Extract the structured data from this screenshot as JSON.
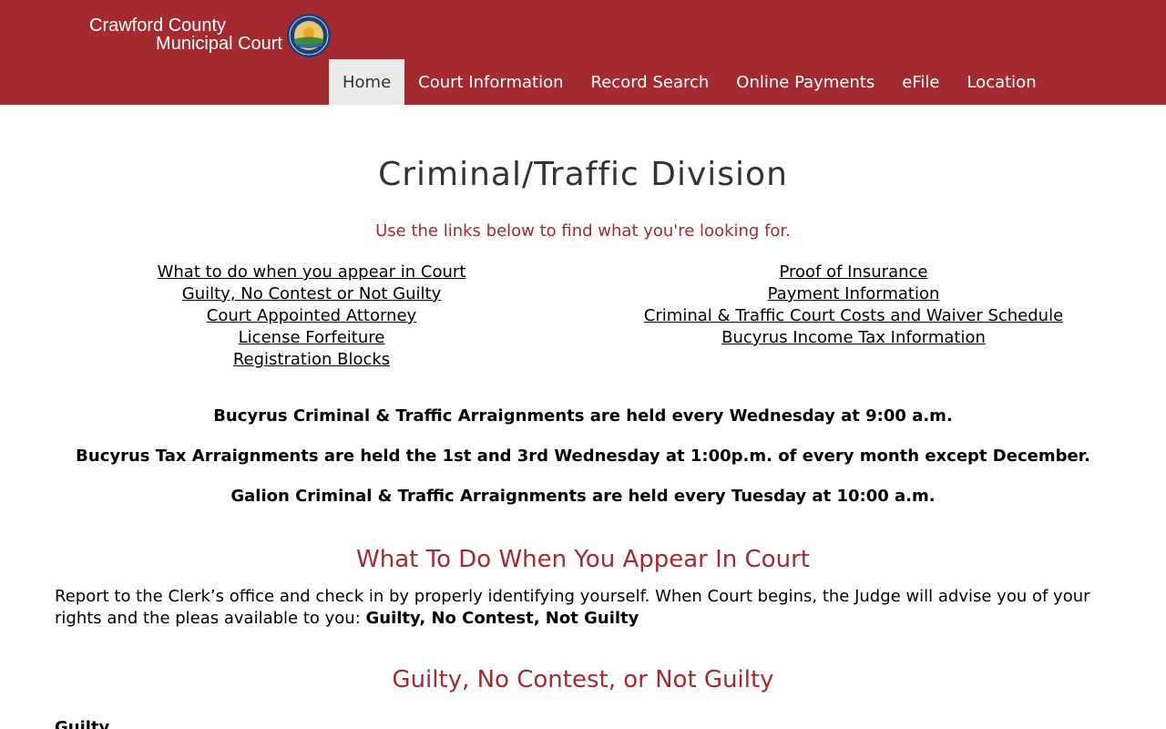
{
  "header": {
    "brand_line1": "Crawford County",
    "brand_line2": "Municipal Court",
    "colors": {
      "brand": "#a32a2f",
      "nav_active_bg": "#ebebeb"
    },
    "nav": [
      {
        "label": "Home",
        "active": true
      },
      {
        "label": "Court Information",
        "active": false
      },
      {
        "label": "Record Search",
        "active": false
      },
      {
        "label": "Online Payments",
        "active": false
      },
      {
        "label": "eFile",
        "active": false
      },
      {
        "label": "Location",
        "active": false
      }
    ]
  },
  "main": {
    "title": "Criminal/Traffic Division",
    "lead": "Use the links below to find what you're looking for.",
    "links_left": [
      "What to do when you appear in Court",
      "Guilty, No Contest or Not Guilty",
      "Court Appointed Attorney",
      "License Forfeiture",
      "Registration Blocks"
    ],
    "links_right": [
      "Proof of Insurance",
      "Payment Information",
      "Criminal & Traffic Court Costs and Waiver Schedule",
      "Bucyrus Income Tax Information"
    ],
    "notices": [
      "Bucyrus Criminal & Traffic Arraignments are held every Wednesday at 9:00 a.m.",
      "Bucyrus Tax Arraignments are held the 1st and 3rd Wednesday at 1:00p.m. of every month except December.",
      "Galion Criminal & Traffic Arraignments are held every Tuesday at 10:00 a.m."
    ],
    "section1": {
      "heading": "What To Do When You Appear In Court",
      "text": "Report to the Clerk’s office and check in by properly identifying yourself. When Court begins, the Judge will advise you of your rights and the pleas available to you: ",
      "bold": "Guilty, No Contest, Not Guilty"
    },
    "section2": {
      "heading": "Guilty, No Contest, or Not Guilty",
      "subhead": "Guilty"
    }
  }
}
